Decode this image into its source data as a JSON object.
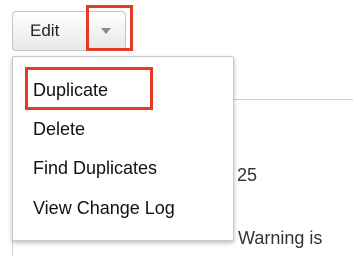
{
  "toolbar": {
    "edit_label": "Edit",
    "caret_icon": "caret-down-icon"
  },
  "menu": {
    "items": [
      {
        "label": "Duplicate",
        "highlighted": true
      },
      {
        "label": "Delete"
      },
      {
        "label": "Find Duplicates"
      },
      {
        "label": "View Change Log"
      }
    ]
  },
  "background": {
    "value_fragment": "25",
    "warning_fragment": "Warning is"
  },
  "colors": {
    "highlight": "#e53a23",
    "button_border": "#c4c4c4"
  }
}
